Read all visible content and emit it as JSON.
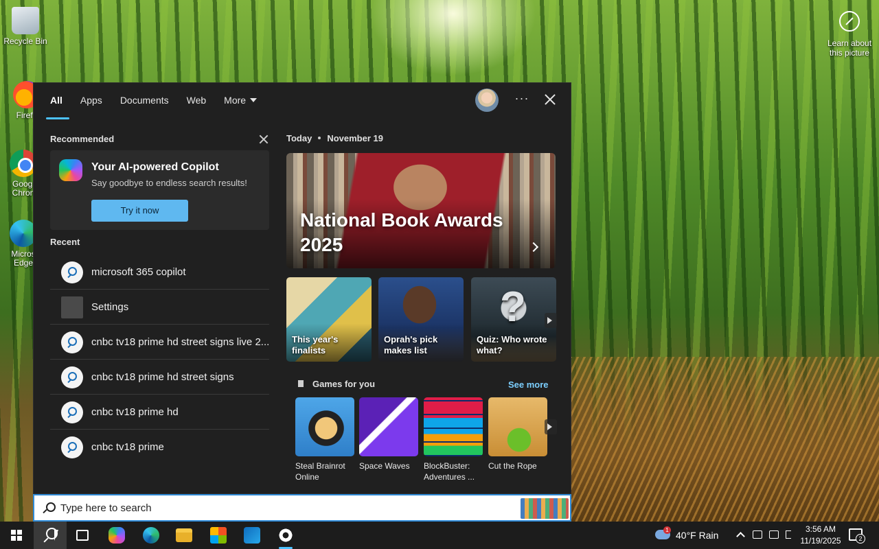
{
  "desktop": {
    "icons": [
      {
        "label": "Recycle Bin"
      },
      {
        "label": "Firefo"
      },
      {
        "label": "Googl Chron"
      },
      {
        "label": "Micros Edge"
      }
    ],
    "learn_about": "Learn about this picture"
  },
  "search_panel": {
    "tabs": [
      {
        "label": "All",
        "active": true
      },
      {
        "label": "Apps"
      },
      {
        "label": "Documents"
      },
      {
        "label": "Web"
      },
      {
        "label": "More"
      }
    ],
    "more_label": "More",
    "dots": "···",
    "recommended": {
      "title": "Recommended",
      "card_title": "Your AI-powered Copilot",
      "card_subtitle": "Say goodbye to endless search results!",
      "button_label": "Try it now"
    },
    "recent": {
      "title": "Recent",
      "items": [
        {
          "label": "microsoft 365 copilot",
          "icon": "search-icon"
        },
        {
          "label": "Settings",
          "icon": "settings-icon"
        },
        {
          "label": "cnbc tv18 prime hd street signs live 2...",
          "icon": "search-icon"
        },
        {
          "label": "cnbc tv18 prime hd street signs",
          "icon": "search-icon"
        },
        {
          "label": "cnbc tv18 prime hd",
          "icon": "search-icon"
        },
        {
          "label": "cnbc tv18 prime",
          "icon": "search-icon"
        }
      ]
    },
    "today": {
      "label": "Today",
      "date": "November 19",
      "hero_title": "National Book Awards 2025",
      "cards": [
        {
          "caption": "This year's finalists"
        },
        {
          "caption": "Oprah's pick makes list"
        },
        {
          "caption": "Quiz: Who wrote what?"
        }
      ]
    },
    "games": {
      "title": "Games for you",
      "see_more": "See more",
      "items": [
        {
          "label": "Steal Brainrot Online"
        },
        {
          "label": "Space Waves"
        },
        {
          "label": "BlockBuster: Adventures ..."
        },
        {
          "label": "Cut the Rope"
        }
      ]
    }
  },
  "search_box": {
    "placeholder": "Type here to search"
  },
  "taskbar": {
    "weather": "40°F  Rain",
    "weather_badge": "1",
    "time": "3:56 AM",
    "date": "11/19/2025",
    "notification_count": "2"
  },
  "colors": {
    "accent": "#4cc2ff",
    "panel_bg": "#202020",
    "taskbar_bg": "#1c1c1c",
    "link": "#7ccfff"
  }
}
